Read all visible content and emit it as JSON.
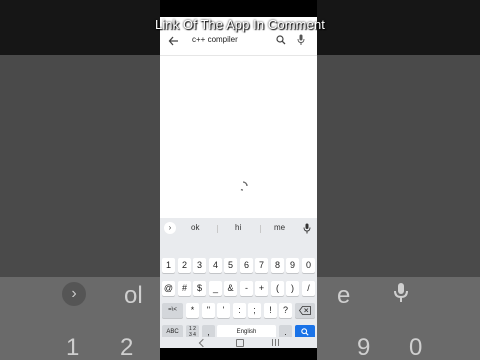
{
  "caption": "Link Of The App In Comment",
  "search": {
    "query": "c++ compiler"
  },
  "suggestions": [
    "ok",
    "hi",
    "me"
  ],
  "rows": {
    "numbers": [
      "1",
      "2",
      "3",
      "4",
      "5",
      "6",
      "7",
      "8",
      "9",
      "0"
    ],
    "symbols1": [
      "@",
      "#",
      "$",
      "_",
      "&",
      "-",
      "+",
      "(",
      ")",
      "/"
    ],
    "symbols2": [
      "=\\<",
      "*",
      "\"",
      "'",
      ":",
      ";",
      "!",
      "?"
    ],
    "bottom": {
      "abc": "ABC",
      "numkey": "1 2\n3 4",
      "comma": ",",
      "space": "English",
      "period": "."
    }
  },
  "background_left_keys": [
    "1",
    "2"
  ],
  "background_right_keys": [
    "9",
    "0"
  ],
  "background_left_word": "ol",
  "background_right_word": "e",
  "colors": {
    "accent": "#1a73e8",
    "keyboard_bg": "#e9ebee"
  }
}
